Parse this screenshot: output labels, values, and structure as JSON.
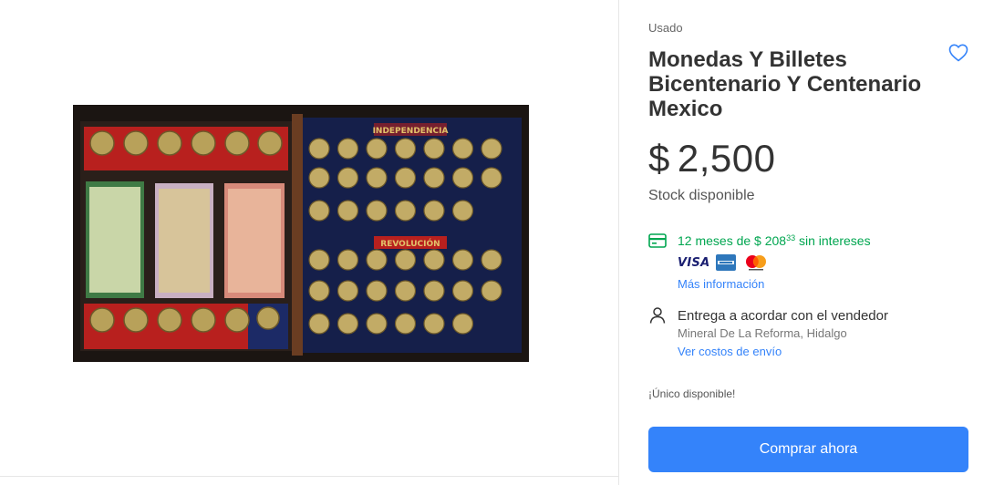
{
  "product": {
    "condition": "Usado",
    "title": "Monedas Y Billetes Bicentenario Y Centenario Mexico",
    "price_currency": "$",
    "price_amount": "2,500",
    "stock": "Stock disponible",
    "image_labels": {
      "left": "INDEPENDENCIA",
      "right": "REVOLUCIÓN"
    }
  },
  "payment": {
    "installments_prefix": "12 meses de $ 208",
    "installments_cents": "33",
    "installments_suffix": " sin intereses",
    "methods": [
      "VISA",
      "amex-card-icon",
      "mastercard-icon"
    ],
    "visa_label": "VISA",
    "more_info": "Más información"
  },
  "delivery": {
    "title": "Entrega a acordar con el vendedor",
    "location": "Mineral De La Reforma, Hidalgo",
    "shipping_link": "Ver costos de envío"
  },
  "availability": "¡Único disponible!",
  "buy_button": "Comprar ahora",
  "colors": {
    "accent": "#3483fa",
    "success": "#00a650",
    "text": "#333333"
  }
}
